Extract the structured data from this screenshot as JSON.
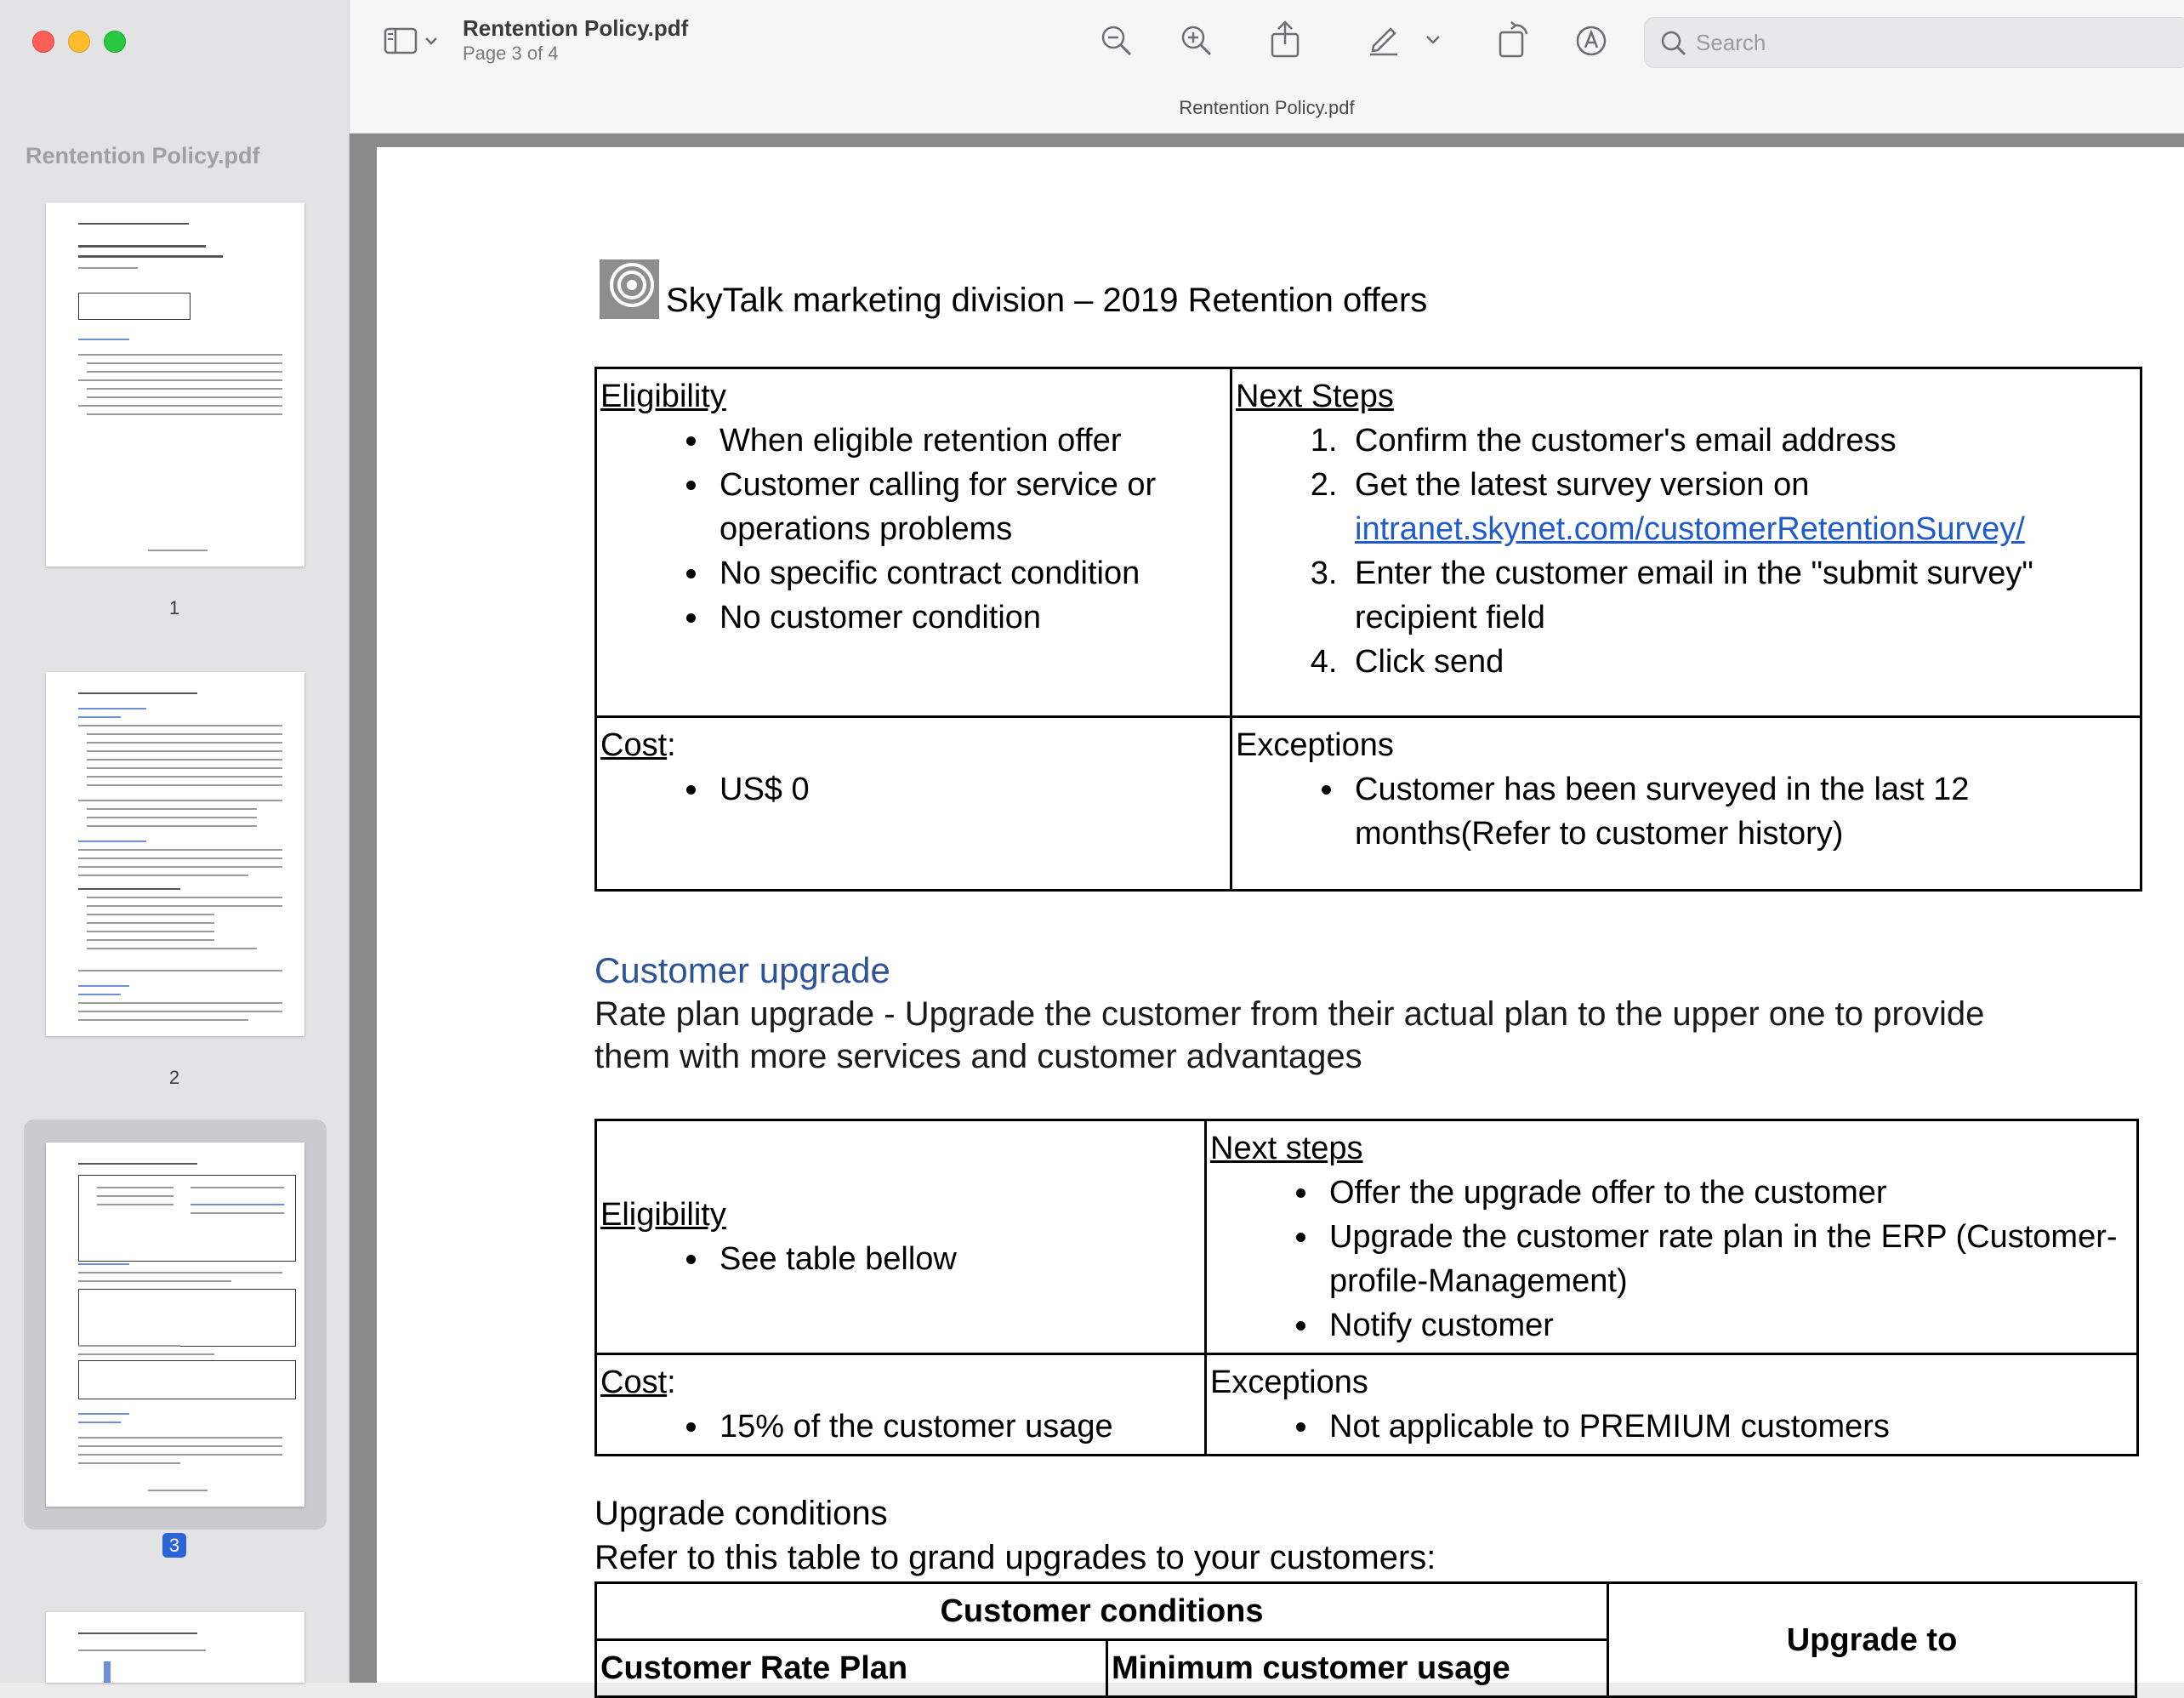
{
  "window": {
    "title": "Rentention Policy.pdf",
    "page_indicator": "Page 3 of 4",
    "center_title": "Rentention Policy.pdf"
  },
  "search": {
    "placeholder": "Search"
  },
  "sidebar": {
    "title": "Rentention Policy.pdf",
    "pages": [
      {
        "num": "1",
        "selected": false
      },
      {
        "num": "2",
        "selected": false
      },
      {
        "num": "3",
        "selected": true
      }
    ]
  },
  "page": {
    "header": "SkyTalk marketing division – 2019 Retention offers",
    "table1": {
      "eligibility_label": "Eligibility",
      "eligibility_items": [
        "When eligible retention offer",
        "Customer calling for service or operations problems",
        "No specific contract condition",
        "No customer condition"
      ],
      "next_steps_label": "Next Steps",
      "step1": "Confirm the customer's email address",
      "step2_prefix": "Get the latest survey version on ",
      "step2_link": "intranet.skynet.com/customerRetentionSurvey/",
      "step3": "Enter the customer email in the \"submit survey\" recipient field",
      "step4": "Click send",
      "cost_label": "Cost",
      "cost_colon": ":",
      "cost_value": "US$ 0",
      "exceptions_label": "Exceptions",
      "exception_item": "Customer has been surveyed in the last 12 months(Refer to customer history)"
    },
    "upgrade": {
      "heading": "Customer upgrade",
      "desc": "Rate plan upgrade - Upgrade the customer from their actual plan to the upper one to provide them with more services and customer advantages"
    },
    "table2": {
      "eligibility_label": "Eligibility",
      "eligibility_item": "See table bellow",
      "next_steps_label": "Next steps",
      "steps": [
        "Offer the upgrade offer to the customer",
        "Upgrade the customer rate plan in the ERP (Customer-profile-Management)",
        "Notify customer"
      ],
      "cost_label": "Cost",
      "cost_colon": ":",
      "cost_value": "15% of the customer usage",
      "exceptions_label": "Exceptions",
      "exception_item": "Not applicable to PREMIUM customers"
    },
    "conditions": {
      "title": "Upgrade conditions",
      "subtitle": "Refer to this table to grand upgrades to your customers:",
      "col_group": "Customer conditions",
      "col1": "Customer Rate Plan",
      "col2": "Minimum customer usage",
      "col3": "Upgrade to"
    }
  }
}
